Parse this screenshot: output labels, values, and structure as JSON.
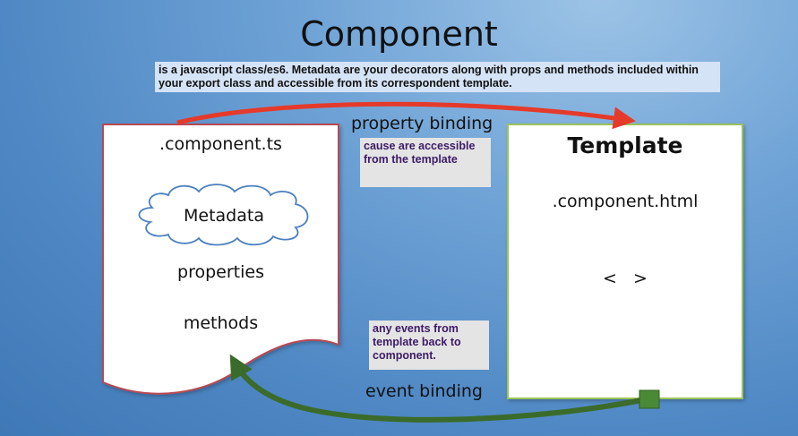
{
  "title": "Component",
  "description_note": "is a javascript class/es6. Metadata are your decorators along with props and methods included within your export class and accessible from its correspondent template.",
  "component_box": {
    "filename": ".component.ts",
    "metadata_label": "Metadata",
    "properties_label": "properties",
    "methods_label": "methods"
  },
  "template_box": {
    "title": "Template",
    "filename": ".component.html",
    "tag_symbol": "<   >"
  },
  "property_binding": {
    "label": "property binding",
    "note": "cause are accessible from the template",
    "color": "#e53a2a"
  },
  "event_binding": {
    "label": "event binding",
    "note": "any events from template back to component.",
    "color": "#3b6b2a"
  },
  "colors": {
    "component_border": "#b84a52",
    "template_border": "#9cc35a",
    "handle": "#4a8a36"
  }
}
